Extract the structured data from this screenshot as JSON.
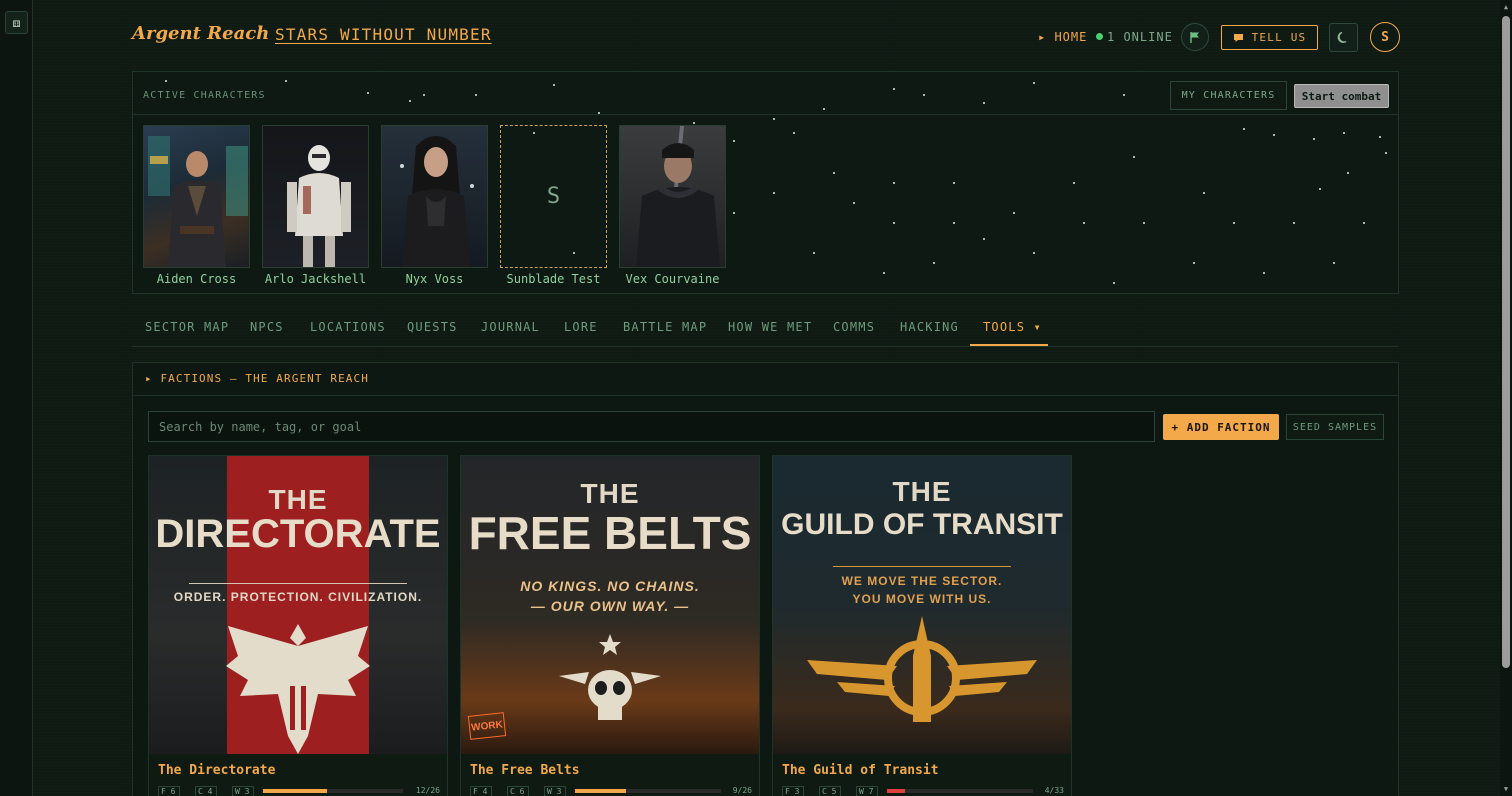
{
  "app": {
    "brand": "Argent Reach",
    "separator": "·",
    "campaign": "STARS WITHOUT NUMBER"
  },
  "header": {
    "home": "▸ HOME",
    "online": "1 ONLINE",
    "tell_us": "TELL US",
    "avatar_letter": "S",
    "flag_icon": "flag-icon",
    "moon_icon": "moon-icon"
  },
  "active_characters": {
    "label": "ACTIVE CHARACTERS",
    "my_characters_button": "MY CHARACTERS",
    "start_combat_button": "Start combat",
    "characters": [
      {
        "name": "Aiden Cross"
      },
      {
        "name": "Arlo Jackshell"
      },
      {
        "name": "Nyx Voss"
      },
      {
        "name": "Sunblade Test",
        "placeholder_initial": "S"
      },
      {
        "name": "Vex Courvaine"
      }
    ]
  },
  "tabs": [
    {
      "label": "SECTOR MAP"
    },
    {
      "label": "NPCS"
    },
    {
      "label": "LOCATIONS"
    },
    {
      "label": "QUESTS"
    },
    {
      "label": "JOURNAL"
    },
    {
      "label": "LORE"
    },
    {
      "label": "BATTLE MAP"
    },
    {
      "label": "HOW WE MET"
    },
    {
      "label": "COMMS"
    },
    {
      "label": "HACKING"
    },
    {
      "label": "TOOLS ▾",
      "active": true
    }
  ],
  "factions": {
    "heading": "▸ FACTIONS — THE ARGENT REACH",
    "search_placeholder": "Search by name, tag, or goal",
    "add_button": "+ ADD FACTION",
    "seed_button": "SEED SAMPLES",
    "cards": [
      {
        "name": "The Directorate",
        "poster_the": "THE",
        "poster_title": "DIRECTORATE",
        "poster_motto": "ORDER. PROTECTION. CIVILIZATION.",
        "stat_f": "F 6",
        "stat_c": "C 4",
        "stat_w": "W 3",
        "hp": "12/26",
        "hp_fraction": 0.46,
        "bar_color": "#f3a94a"
      },
      {
        "name": "The Free Belts",
        "poster_the": "THE",
        "poster_title": "FREE BELTS",
        "poster_motto": "NO KINGS. NO CHAINS.",
        "poster_motto_b": "— OUR OWN WAY. —",
        "stat_f": "F 4",
        "stat_c": "C 6",
        "stat_w": "W 3",
        "hp": "9/26",
        "hp_fraction": 0.35,
        "bar_color": "#f3a94a"
      },
      {
        "name": "The Guild of Transit",
        "poster_the": "THE",
        "poster_title": "GUILD OF TRANSIT",
        "poster_motto": "WE MOVE THE SECTOR.",
        "poster_motto_b": "YOU MOVE WITH US.",
        "stat_f": "F 3",
        "stat_c": "C 5",
        "stat_w": "W 7",
        "hp": "4/33",
        "hp_fraction": 0.12,
        "bar_color": "#e0413c"
      }
    ]
  },
  "colors": {
    "accent": "#f3a94a",
    "background": "#0f1a13",
    "online_dot": "#4cd06d"
  }
}
